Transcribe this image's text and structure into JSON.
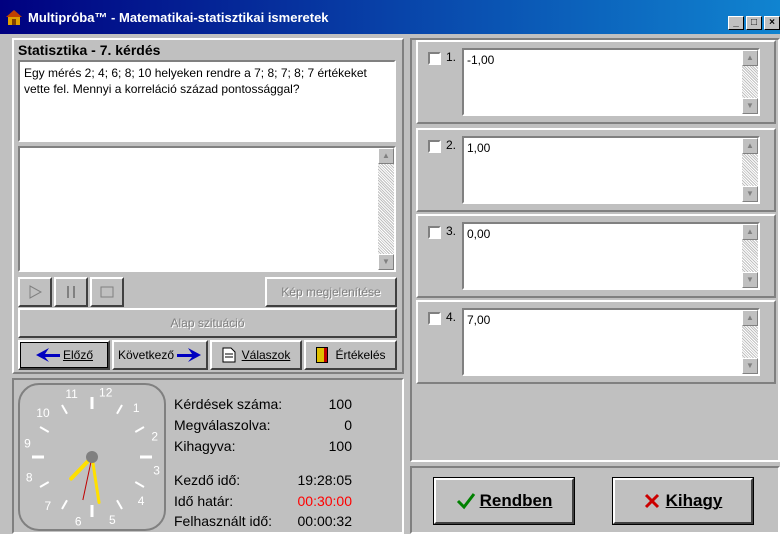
{
  "window": {
    "title": "Multipróba™ - Matematikai-statisztikai ismeretek",
    "minimize": "_",
    "maximize": "□",
    "close": "×"
  },
  "question": {
    "header": "Statisztika - 7. kérdés",
    "text": "Egy mérés 2; 4; 6; 8; 10 helyeken rendre a 7; 8; 7; 8; 7 értékeket vette fel. Mennyi a korreláció század pontossággal?"
  },
  "media": {
    "show_image": "Kép megjelenítése",
    "base_situation": "Alap szituáció"
  },
  "nav": {
    "prev": "Előző",
    "next": "Következő",
    "answers": "Válaszok",
    "evaluation": "Értékelés"
  },
  "stats": {
    "questions_label": "Kérdések száma:",
    "questions_value": "100",
    "answered_label": "Megválaszolva:",
    "answered_value": "0",
    "skipped_label": "Kihagyva:",
    "skipped_value": "100",
    "start_label": "Kezdő idő:",
    "start_value": "19:28:05",
    "limit_label": "Idő határ:",
    "limit_value": "00:30:00",
    "used_label": "Felhasznált idő:",
    "used_value": "00:00:32"
  },
  "clock": {
    "numbers": [
      "12",
      "1",
      "2",
      "3",
      "4",
      "5",
      "6",
      "7",
      "8",
      "9",
      "10",
      "11"
    ],
    "time": "19:28:32"
  },
  "answers": [
    {
      "num": "1.",
      "value": "-1,00"
    },
    {
      "num": "2.",
      "value": "1,00"
    },
    {
      "num": "3.",
      "value": "0,00"
    },
    {
      "num": "4.",
      "value": "7,00"
    }
  ],
  "actions": {
    "ok": "Rendben",
    "skip": "Kihagy"
  },
  "colors": {
    "title_bar": "#000080",
    "time_limit": "#ff0000",
    "ok_check": "#008000",
    "skip_x": "#cc0000"
  }
}
